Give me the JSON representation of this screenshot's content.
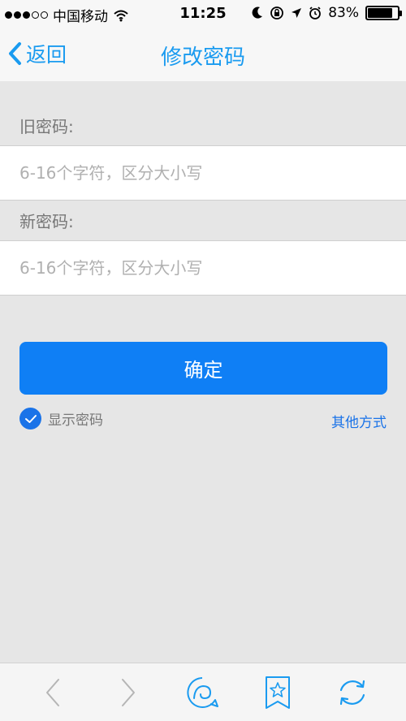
{
  "status_bar": {
    "carrier": "中国移动",
    "time": "11:25",
    "battery_percent": "83%",
    "battery_level": 0.83,
    "icons": [
      "signal-dots",
      "wifi-icon",
      "moon-icon",
      "rotation-lock-icon",
      "location-icon",
      "alarm-icon",
      "battery-icon"
    ]
  },
  "nav": {
    "back_label": "返回",
    "title": "修改密码"
  },
  "form": {
    "old_password_label": "旧密码:",
    "old_password_placeholder": "6-16个字符，区分大小写",
    "old_password_value": "",
    "new_password_label": "新密码:",
    "new_password_placeholder": "6-16个字符，区分大小写",
    "new_password_value": "",
    "confirm_label": "确定",
    "show_password_label": "显示密码",
    "show_password_checked": true,
    "other_way_label": "其他方式"
  },
  "toolbar": {
    "icons": [
      "back-arrow-icon",
      "forward-arrow-icon",
      "home-chat-icon",
      "bookmark-star-icon",
      "refresh-icon"
    ]
  },
  "colors": {
    "accent": "#1a9bf0",
    "button": "#0f7ff5",
    "background": "#e6e6e6",
    "toolbar_icon": "#1a9bf0"
  }
}
